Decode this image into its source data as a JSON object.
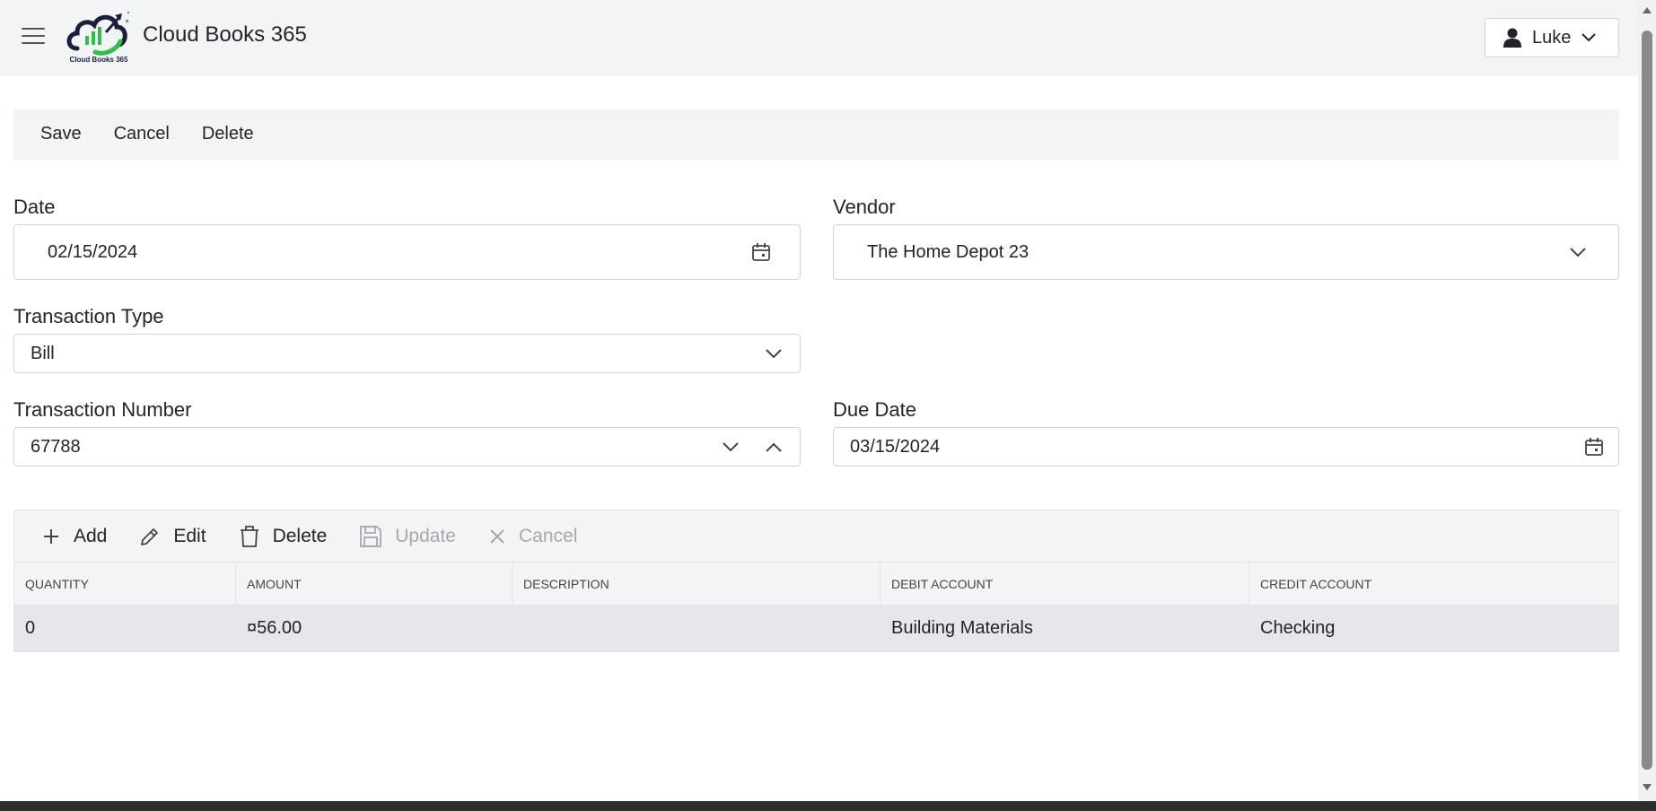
{
  "app": {
    "title": "Cloud Books 365",
    "logo_text": "Cloud Books 365"
  },
  "user": {
    "name": "Luke"
  },
  "toolbar": {
    "save_label": "Save",
    "cancel_label": "Cancel",
    "delete_label": "Delete"
  },
  "form": {
    "date": {
      "label": "Date",
      "value": "02/15/2024"
    },
    "vendor": {
      "label": "Vendor",
      "value": "The Home Depot 23"
    },
    "transaction_type": {
      "label": "Transaction Type",
      "value": "Bill"
    },
    "transaction_number": {
      "label": "Transaction Number",
      "value": "67788"
    },
    "due_date": {
      "label": "Due Date",
      "value": "03/15/2024"
    }
  },
  "grid": {
    "toolbar": {
      "add_label": "Add",
      "edit_label": "Edit",
      "delete_label": "Delete",
      "update_label": "Update",
      "cancel_label": "Cancel"
    },
    "columns": [
      "QUANTITY",
      "AMOUNT",
      "DESCRIPTION",
      "DEBIT ACCOUNT",
      "CREDIT ACCOUNT"
    ],
    "rows": [
      {
        "quantity": "0",
        "amount": "¤56.00",
        "description": "",
        "debit_account": "Building Materials",
        "credit_account": "Checking"
      }
    ]
  },
  "icons": {
    "menu": "hamburger-menu-icon",
    "user": "user-icon",
    "calendar": "calendar-icon",
    "chevron_down": "chevron-down-icon",
    "chevron_up": "chevron-up-icon",
    "add": "plus-icon",
    "edit": "pencil-icon",
    "delete": "trash-icon",
    "update": "save-icon",
    "cancel": "close-icon"
  },
  "colors": {
    "header_bg": "#f3f4f6",
    "row_selected_bg": "#e6e7ea",
    "logo_dark": "#1a1f3a",
    "logo_green": "#2fbf4a"
  }
}
